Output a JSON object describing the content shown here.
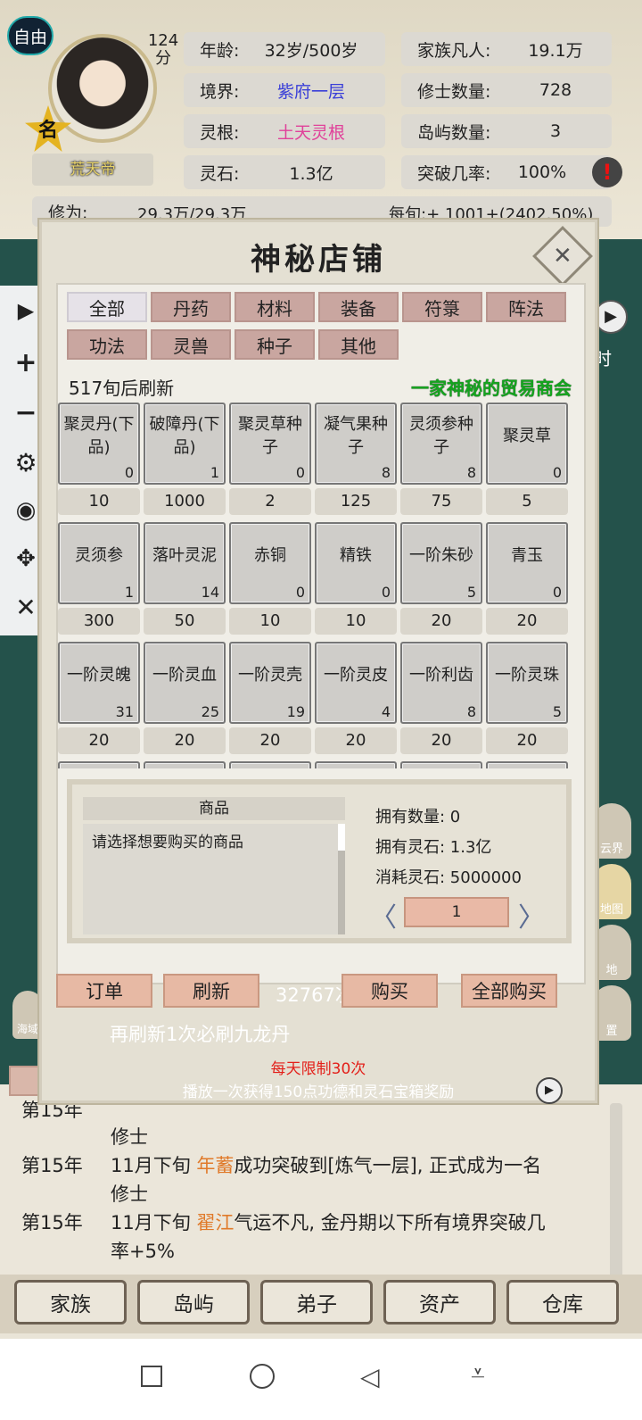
{
  "profile": {
    "mode_badge": "自由",
    "score": "124",
    "score_unit": "分",
    "name_badge": "名",
    "title": "荒天帝",
    "age_label": "年龄:",
    "age_value": "32岁/500岁",
    "realm_label": "境界:",
    "realm_value": "紫府一层",
    "root_label": "灵根:",
    "root_value": "土天灵根",
    "stone_label": "灵石:",
    "stone_value": "1.3亿",
    "family_label": "家族凡人:",
    "family_value": "19.1万",
    "cultivator_label": "修士数量:",
    "cultivator_value": "728",
    "island_label": "岛屿数量:",
    "island_value": "3",
    "break_label": "突破几率:",
    "break_value": "100%",
    "cultivation_label": "修为:",
    "cultivation_value": "29.3万/29.3万",
    "per_turn": "每旬:+ 1001+(2402.50%)"
  },
  "shop": {
    "title": "神秘店铺",
    "tabs": [
      "全部",
      "丹药",
      "材料",
      "装备",
      "符箓",
      "阵法",
      "功法",
      "灵兽",
      "种子",
      "其他"
    ],
    "refresh_info": "517旬后刷新",
    "subtitle": "一家神秘的贸易商会",
    "items": [
      {
        "name": "聚灵丹(下品)",
        "count": "0",
        "price": "10"
      },
      {
        "name": "破障丹(下品)",
        "count": "1",
        "price": "1000"
      },
      {
        "name": "聚灵草种子",
        "count": "0",
        "price": "2"
      },
      {
        "name": "凝气果种子",
        "count": "8",
        "price": "125"
      },
      {
        "name": "灵须参种子",
        "count": "8",
        "price": "75"
      },
      {
        "name": "聚灵草",
        "count": "0",
        "price": "5"
      },
      {
        "name": "灵须参",
        "count": "1",
        "price": "300"
      },
      {
        "name": "落叶灵泥",
        "count": "14",
        "price": "50"
      },
      {
        "name": "赤铜",
        "count": "0",
        "price": "10"
      },
      {
        "name": "精铁",
        "count": "0",
        "price": "10"
      },
      {
        "name": "一阶朱砂",
        "count": "5",
        "price": "20"
      },
      {
        "name": "青玉",
        "count": "0",
        "price": "20"
      },
      {
        "name": "一阶灵魄",
        "count": "31",
        "price": "20"
      },
      {
        "name": "一阶灵血",
        "count": "25",
        "price": "20"
      },
      {
        "name": "一阶灵壳",
        "count": "19",
        "price": "20"
      },
      {
        "name": "一阶灵皮",
        "count": "4",
        "price": "20"
      },
      {
        "name": "一阶利齿",
        "count": "8",
        "price": "20"
      },
      {
        "name": "一阶灵珠",
        "count": "5",
        "price": "20"
      }
    ],
    "detail": {
      "header": "商品",
      "desc": "请选择想要购买的商品",
      "own_count": "拥有数量: 0",
      "own_stone": "拥有灵石: 1.3亿",
      "cost": "消耗灵石: 5000000",
      "quantity": "1"
    },
    "buttons": {
      "order": "订单",
      "refresh": "刷新",
      "times": "32767次",
      "buy": "购买",
      "buy_all": "全部购买"
    },
    "hint": "再刷新1次必刷九龙丹",
    "limit": "每天限制30次",
    "ad_text": "播放一次获得150点功德和灵石宝箱奖励"
  },
  "side_right": {
    "time_label": "时",
    "world_label": "云界",
    "map_label": "地图",
    "land_label": "地",
    "setting_label": "置",
    "sea_label": "海域"
  },
  "log": [
    {
      "year": "第15年",
      "text_a": "11月下旬 ",
      "name": "年蓄",
      "text_b": "成功突破到[炼气一层], 正式成为一名",
      "line2": "修士"
    },
    {
      "year": "第15年",
      "text_a": "11月下旬 ",
      "name": "翟江",
      "text_b": "气运不凡, 金丹期以下所有境界突破几",
      "line2": "率+5%"
    }
  ],
  "log_partial": "第15年",
  "log_partial_line2": "修士",
  "nav": [
    "家族",
    "岛屿",
    "弟子",
    "资产",
    "仓库"
  ],
  "colors": {
    "realm": "#3a3fd8",
    "root": "#e0419a",
    "subtitle": "#14a51e",
    "log_name": "#e07a2a",
    "limit": "#e3201a"
  }
}
